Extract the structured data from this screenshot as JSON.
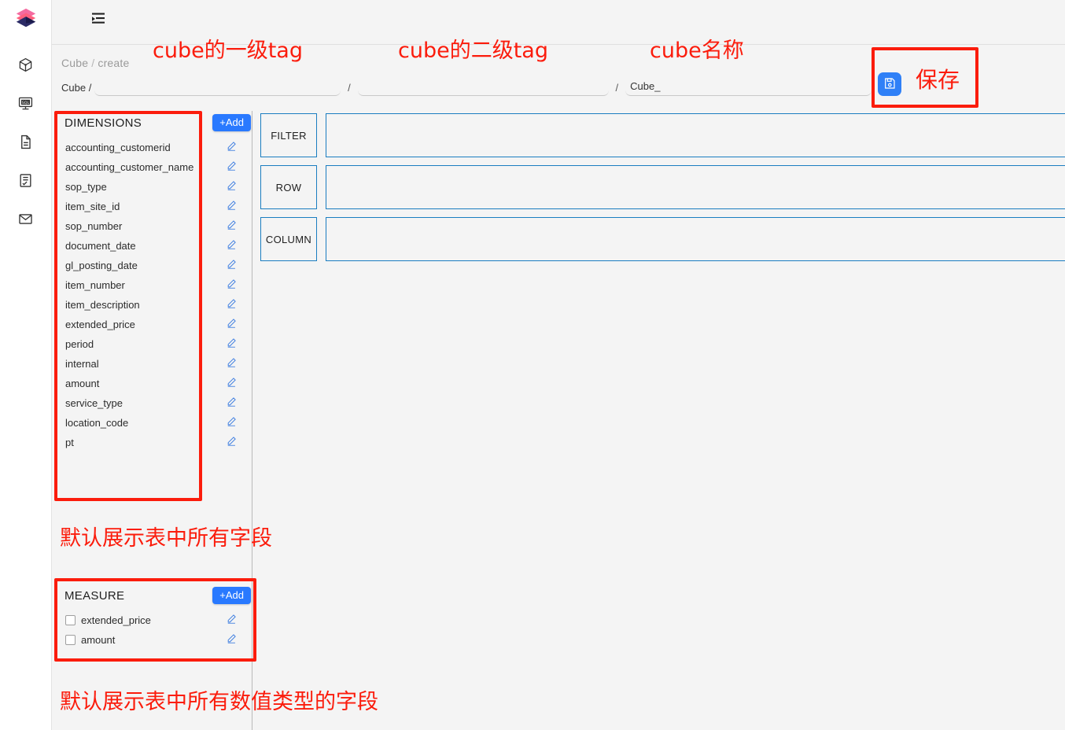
{
  "app": {
    "logo_icon": "prism-logo-icon",
    "collapse_icon": "collapse-sidebar-icon"
  },
  "sidebar": {
    "items": [
      {
        "icon": "cube-icon",
        "name": "sidebar-item-cube"
      },
      {
        "icon": "sql-monitor-icon",
        "name": "sidebar-item-sql"
      },
      {
        "icon": "document-icon",
        "name": "sidebar-item-document"
      },
      {
        "icon": "report-icon",
        "name": "sidebar-item-report"
      },
      {
        "icon": "mail-icon",
        "name": "sidebar-item-mail"
      }
    ]
  },
  "breadcrumb": {
    "root": "Cube",
    "separator": "/",
    "current": "create"
  },
  "tag_row": {
    "prefix": "Cube /",
    "slash": "/",
    "level1_value": "",
    "level1_placeholder": "",
    "level2_value": "",
    "level2_placeholder": "",
    "name_value": "Cube_",
    "name_placeholder": "Cube_"
  },
  "save": {
    "icon": "save-disk-icon",
    "accent": "#2f80f7"
  },
  "dimensions": {
    "title": "DIMENSIONS",
    "add_label": "+Add",
    "edit_icon": "pencil-edit-icon",
    "fields": [
      "accounting_customerid",
      "accounting_customer_name",
      "sop_type",
      "item_site_id",
      "sop_number",
      "document_date",
      "gl_posting_date",
      "item_number",
      "item_description",
      "extended_price",
      "period",
      "internal",
      "amount",
      "service_type",
      "location_code",
      "pt"
    ]
  },
  "drag_handle": "·····",
  "measure": {
    "title": "MEASURE",
    "add_label": "+Add",
    "edit_icon": "pencil-edit-icon",
    "fields": [
      {
        "label": "extended_price",
        "checked": false
      },
      {
        "label": "amount",
        "checked": false
      }
    ]
  },
  "drop_zones": [
    {
      "label": "FILTER",
      "items": []
    },
    {
      "label": "ROW",
      "items": []
    },
    {
      "label": "COLUMN",
      "items": []
    }
  ],
  "annotations": {
    "color": "#fb1c0c",
    "tag_level1": "cube的一级tag",
    "tag_level2": "cube的二级tag",
    "cube_name": "cube名称",
    "save": "保存",
    "dimensions_note": "默认展示表中所有字段",
    "measure_note": "默认展示表中所有数值类型的字段"
  }
}
